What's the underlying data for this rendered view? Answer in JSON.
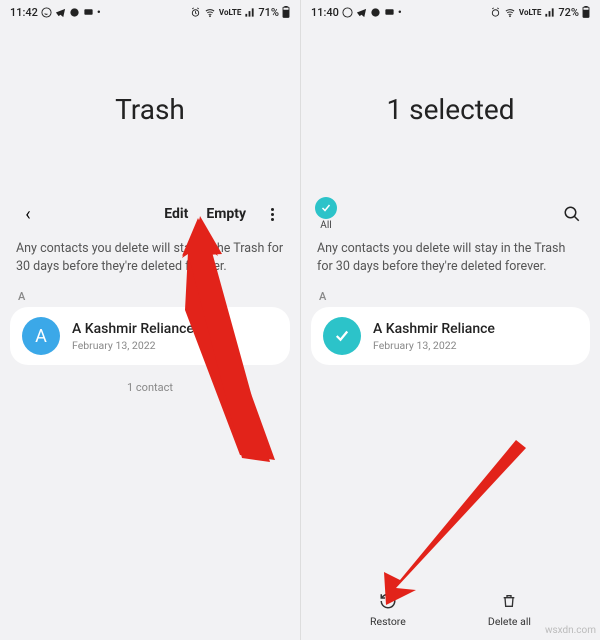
{
  "left": {
    "status": {
      "time": "11:42",
      "battery": "71%",
      "net": "VoLTE"
    },
    "title": "Trash",
    "toolbar": {
      "edit": "Edit",
      "empty": "Empty"
    },
    "info": "Any contacts you delete will stay in the Trash for 30 days before they're deleted forever.",
    "section": "A",
    "contact": {
      "initial": "A",
      "name": "A Kashmir Reliance",
      "date": "February 13, 2022"
    },
    "count": "1 contact"
  },
  "right": {
    "status": {
      "time": "11:40",
      "battery": "72%",
      "net": "VoLTE"
    },
    "title": "1 selected",
    "all_label": "All",
    "info": "Any contacts you delete will stay in the Trash for 30 days before they're deleted forever.",
    "section": "A",
    "contact": {
      "name": "A Kashmir Reliance",
      "date": "February 13, 2022"
    },
    "bottom": {
      "restore": "Restore",
      "delete_all": "Delete all"
    }
  },
  "watermark": "wsxdn.com"
}
